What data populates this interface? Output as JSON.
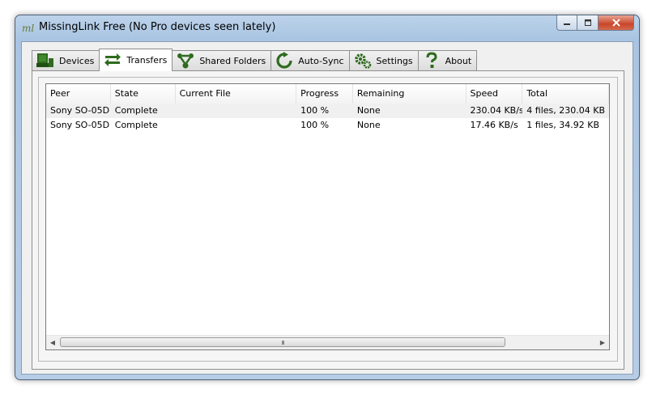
{
  "window": {
    "title": "MissingLink Free (No Pro devices seen lately)",
    "app_icon_text": "ml",
    "controls": [
      "minimize",
      "maximize",
      "close"
    ]
  },
  "tabs": [
    {
      "label": "Devices",
      "icon": "devices-icon",
      "active": false
    },
    {
      "label": "Transfers",
      "icon": "transfers-icon",
      "active": true
    },
    {
      "label": "Shared Folders",
      "icon": "shared-folders-icon",
      "active": false
    },
    {
      "label": "Auto-Sync",
      "icon": "auto-sync-icon",
      "active": false
    },
    {
      "label": "Settings",
      "icon": "settings-icon",
      "active": false
    },
    {
      "label": "About",
      "icon": "about-icon",
      "active": false
    }
  ],
  "table": {
    "columns": [
      "Peer",
      "State",
      "Current File",
      "Progress",
      "Remaining",
      "Speed",
      "Total"
    ],
    "rows": [
      [
        "Sony SO-05D",
        "Complete",
        "",
        "100 %",
        "None",
        "230.04 KB/s",
        "4 files, 230.04 KB"
      ],
      [
        "Sony SO-05D",
        "Complete",
        "",
        "100 %",
        "None",
        "17.46 KB/s",
        "1 files, 34.92 KB"
      ]
    ]
  },
  "scrollbar": {
    "grip": "III"
  },
  "colors": {
    "icon_green": "#2e6b1e",
    "close_red": "#c9462a"
  }
}
